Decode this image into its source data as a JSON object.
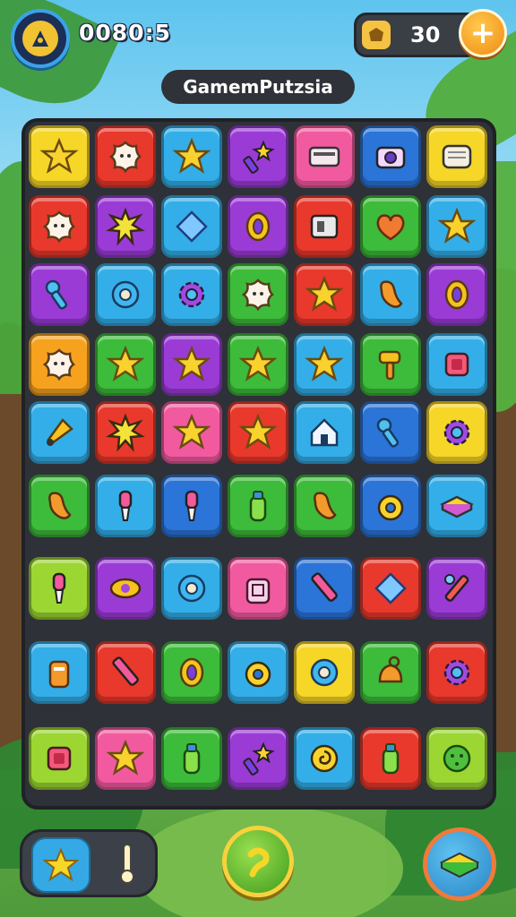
{
  "hud": {
    "timer": "0080:5",
    "coins": "30",
    "add_label": "+",
    "title": "GamemPutzsia"
  },
  "colors": {
    "yellow": "#f6d627",
    "red": "#e8392c",
    "blue": "#33aee8",
    "purple": "#9a3bd6",
    "pink": "#f25aa0",
    "green": "#3dbb3a",
    "lime": "#9bd632",
    "orange": "#f6a21e",
    "deepblue": "#2b74d8"
  },
  "board": {
    "rows": [
      [
        {
          "color": "yellow",
          "icon": "star-icon"
        },
        {
          "color": "red",
          "icon": "flower-icon"
        },
        {
          "color": "blue",
          "icon": "star-icon"
        },
        {
          "color": "purple",
          "icon": "wand-icon"
        },
        {
          "color": "pink",
          "icon": "card-icon"
        },
        {
          "color": "deepblue",
          "icon": "camera-icon"
        },
        {
          "color": "yellow",
          "icon": "scroll-icon"
        }
      ],
      [
        {
          "color": "red",
          "icon": "flower-icon"
        },
        {
          "color": "purple",
          "icon": "burst-icon"
        },
        {
          "color": "blue",
          "icon": "diamond-icon"
        },
        {
          "color": "purple",
          "icon": "ring-icon"
        },
        {
          "color": "red",
          "icon": "battery-icon"
        },
        {
          "color": "green",
          "icon": "heart-icon"
        },
        {
          "color": "blue",
          "icon": "star-icon"
        }
      ],
      [
        {
          "color": "purple",
          "icon": "key-icon"
        },
        {
          "color": "blue",
          "icon": "bubble-icon"
        },
        {
          "color": "blue",
          "icon": "gear-icon"
        },
        {
          "color": "green",
          "icon": "flower-icon"
        },
        {
          "color": "red",
          "icon": "star-icon"
        },
        {
          "color": "blue",
          "icon": "bean-icon"
        },
        {
          "color": "purple",
          "icon": "ring-icon"
        }
      ],
      [
        {
          "color": "orange",
          "icon": "flower-icon"
        },
        {
          "color": "green",
          "icon": "star-icon"
        },
        {
          "color": "purple",
          "icon": "star-icon"
        },
        {
          "color": "green",
          "icon": "star-icon"
        },
        {
          "color": "blue",
          "icon": "star-icon"
        },
        {
          "color": "green",
          "icon": "hammer-icon"
        },
        {
          "color": "blue",
          "icon": "square-icon"
        }
      ],
      [
        {
          "color": "blue",
          "icon": "cone-icon"
        },
        {
          "color": "red",
          "icon": "burst-icon"
        },
        {
          "color": "pink",
          "icon": "star-icon"
        },
        {
          "color": "red",
          "icon": "star-icon"
        },
        {
          "color": "blue",
          "icon": "house-icon"
        },
        {
          "color": "deepblue",
          "icon": "key-icon"
        },
        {
          "color": "yellow",
          "icon": "gear-icon"
        }
      ],
      [
        {
          "color": "green",
          "icon": "bean-icon"
        },
        {
          "color": "blue",
          "icon": "brush-icon"
        },
        {
          "color": "deepblue",
          "icon": "brush-icon"
        },
        {
          "color": "green",
          "icon": "bottle-icon"
        },
        {
          "color": "green",
          "icon": "bean-icon"
        },
        {
          "color": "deepblue",
          "icon": "donut-icon"
        },
        {
          "color": "blue",
          "icon": "book-icon"
        }
      ],
      [
        {
          "color": "lime",
          "icon": "brush-icon"
        },
        {
          "color": "purple",
          "icon": "eye-icon"
        },
        {
          "color": "blue",
          "icon": "bubble-icon"
        },
        {
          "color": "pink",
          "icon": "bag-icon"
        },
        {
          "color": "deepblue",
          "icon": "pencil-icon"
        },
        {
          "color": "red",
          "icon": "diamond-icon"
        },
        {
          "color": "purple",
          "icon": "wrench-icon"
        }
      ],
      [
        {
          "color": "blue",
          "icon": "jar-icon"
        },
        {
          "color": "red",
          "icon": "pencil-icon"
        },
        {
          "color": "green",
          "icon": "ring-icon"
        },
        {
          "color": "blue",
          "icon": "donut-icon"
        },
        {
          "color": "yellow",
          "icon": "bubble-icon"
        },
        {
          "color": "green",
          "icon": "bell-icon"
        },
        {
          "color": "red",
          "icon": "gear-icon"
        }
      ],
      [
        {
          "color": "lime",
          "icon": "square-icon"
        },
        {
          "color": "pink",
          "icon": "star-icon"
        },
        {
          "color": "green",
          "icon": "bottle-icon"
        },
        {
          "color": "purple",
          "icon": "wand-icon"
        },
        {
          "color": "blue",
          "icon": "swirl-icon"
        },
        {
          "color": "red",
          "icon": "bottle-icon"
        },
        {
          "color": "lime",
          "icon": "blob-icon"
        }
      ]
    ]
  },
  "footer": {
    "left_icons": [
      "star-icon",
      "thermometer-icon"
    ],
    "hint_icon": "hook-icon",
    "book_icon": "book-icon"
  }
}
